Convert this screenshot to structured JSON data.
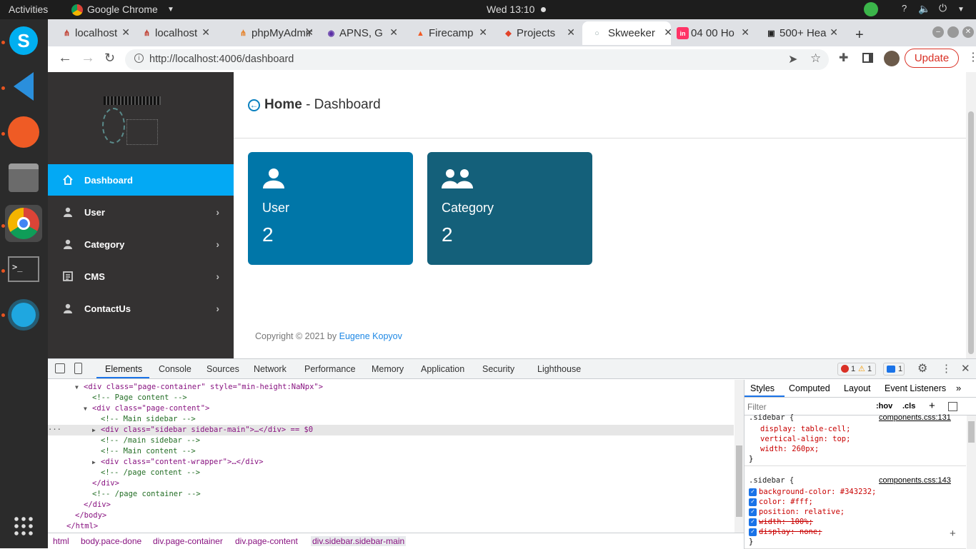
{
  "os_topbar": {
    "activities": "Activities",
    "app_menu": "Google Chrome",
    "clock": "Wed 13:10"
  },
  "browser": {
    "tabs": [
      {
        "title": "localhost",
        "favicon": "apache-feather-icon"
      },
      {
        "title": "localhost",
        "favicon": "apache-feather-icon"
      },
      {
        "title": "phpMyAdmin",
        "favicon": "phpmyadmin-icon"
      },
      {
        "title": "APNS, G",
        "favicon": "shield-icon"
      },
      {
        "title": "Firecamp",
        "favicon": "firecamp-icon"
      },
      {
        "title": "Projects",
        "favicon": "gitlab-icon"
      },
      {
        "title": "Skweeker",
        "favicon": "circle-icon"
      },
      {
        "title": "04 00 Ho",
        "favicon": "invision-icon"
      },
      {
        "title": "500+ Hea",
        "favicon": "unsplash-icon"
      }
    ],
    "url": "http://localhost:4006/dashboard",
    "update_label": "Update",
    "new_tab_label": "+"
  },
  "app": {
    "page_header": {
      "strong": "Home",
      "rest": " - Dashboard"
    },
    "sidebar": {
      "items": [
        {
          "label": "Dashboard",
          "icon": "home-icon",
          "active": true,
          "chevron": ""
        },
        {
          "label": "User",
          "icon": "user-icon",
          "active": false,
          "chevron": "›"
        },
        {
          "label": "Category",
          "icon": "user-icon",
          "active": false,
          "chevron": "›"
        },
        {
          "label": "CMS",
          "icon": "document-icon",
          "active": false,
          "chevron": "›"
        },
        {
          "label": "ContactUs",
          "icon": "user-icon",
          "active": false,
          "chevron": "›"
        }
      ]
    },
    "cards": [
      {
        "label": "User",
        "count": "2",
        "icon": "user-icon",
        "color": "#0076a8"
      },
      {
        "label": "Category",
        "count": "2",
        "icon": "users-icon",
        "color": "#14607a"
      }
    ],
    "footer": {
      "text": "Copyright © 2021 by ",
      "link": "Eugene Kopyov"
    }
  },
  "devtools": {
    "tabs": [
      "Elements",
      "Console",
      "Sources",
      "Network",
      "Performance",
      "Memory",
      "Application",
      "Security",
      "Lighthouse"
    ],
    "badges": {
      "errors": "1",
      "warnings": "1",
      "messages": "1"
    },
    "dom_lines": [
      {
        "indent": 2,
        "arrow": "▼",
        "text": "<div class=\"page-container\" style=\"min-height:NaNpx\">"
      },
      {
        "indent": 3,
        "arrow": "",
        "text": "<!-- Page content -->"
      },
      {
        "indent": 3,
        "arrow": "▼",
        "text": "<div class=\"page-content\">"
      },
      {
        "indent": 4,
        "arrow": "",
        "text": "<!-- Main sidebar -->"
      },
      {
        "indent": 4,
        "arrow": "▶",
        "text": "<div class=\"sidebar sidebar-main\">…</div> == $0",
        "selected": true
      },
      {
        "indent": 4,
        "arrow": "",
        "text": "<!-- /main sidebar -->"
      },
      {
        "indent": 4,
        "arrow": "",
        "text": "<!-- Main content -->"
      },
      {
        "indent": 4,
        "arrow": "▶",
        "text": "<div class=\"content-wrapper\">…</div>"
      },
      {
        "indent": 4,
        "arrow": "",
        "text": "<!-- /page content -->"
      },
      {
        "indent": 3,
        "arrow": "",
        "text": "</div>"
      },
      {
        "indent": 3,
        "arrow": "",
        "text": "<!-- /page container -->"
      },
      {
        "indent": 2,
        "arrow": "",
        "text": "</div>"
      },
      {
        "indent": 1,
        "arrow": "",
        "text": "</body>"
      },
      {
        "indent": 0,
        "arrow": "",
        "text": "</html>"
      }
    ],
    "breadcrumbs": [
      "html",
      "body.pace-done",
      "div.page-container",
      "div.page-content",
      "div.sidebar.sidebar-main"
    ],
    "styles_tabs": [
      "Styles",
      "Computed",
      "Layout",
      "Event Listeners"
    ],
    "filter_placeholder": "Filter",
    "hov": ":hov",
    "cls": ".cls",
    "rules": [
      {
        "selector": ".sidebar {",
        "source": "components.css:131",
        "props": [
          "display: table-cell;",
          "vertical-align: top;",
          "width: 260px;"
        ],
        "checkboxes": false
      },
      {
        "selector": ".sidebar {",
        "source": "components.css:143",
        "props": [
          "background-color: #343232;",
          "color: #fff;",
          "position: relative;",
          "width: 100%;",
          "display: none;"
        ],
        "checkboxes": true
      }
    ]
  }
}
